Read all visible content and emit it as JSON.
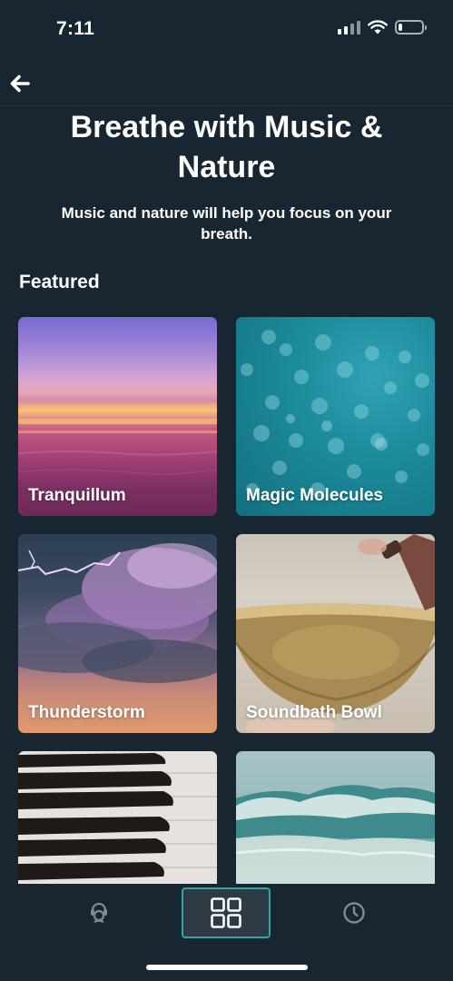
{
  "status_bar": {
    "time": "7:11",
    "battery_level": 0.15
  },
  "nav": {
    "back_icon": "arrow-left-icon"
  },
  "header": {
    "title": "Breathe with Music & Nature",
    "subtitle": "Music and nature will help you focus on your breath."
  },
  "featured": {
    "heading": "Featured",
    "items": [
      {
        "label": "Tranquillum"
      },
      {
        "label": "Magic Molecules"
      },
      {
        "label": "Thunderstorm"
      },
      {
        "label": "Soundbath Bowl"
      },
      {
        "label": ""
      },
      {
        "label": ""
      }
    ]
  },
  "tab_bar": {
    "tabs": [
      {
        "icon": "breathe-head-icon",
        "selected": false
      },
      {
        "icon": "grid-icon",
        "selected": true
      },
      {
        "icon": "clock-icon",
        "selected": false
      }
    ],
    "accent_color": "#2fa7a7"
  },
  "colors": {
    "background": "#182631"
  }
}
